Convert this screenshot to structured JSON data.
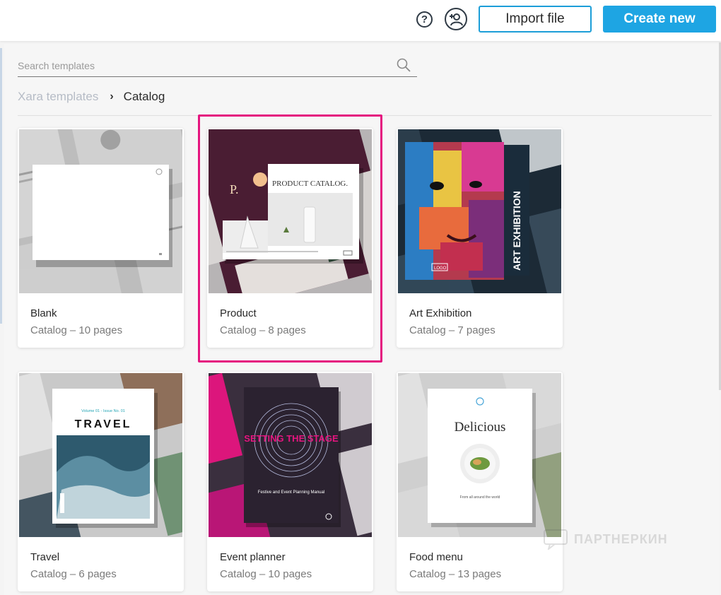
{
  "header": {
    "help_icon_glyph": "?",
    "import_label": "Import file",
    "create_label": "Create new"
  },
  "search": {
    "placeholder": "Search templates",
    "value": ""
  },
  "breadcrumb": {
    "root": "Xara templates",
    "separator": "›",
    "current": "Catalog"
  },
  "templates": [
    {
      "title": "Blank",
      "subtitle": "Catalog – 10 pages"
    },
    {
      "title": "Product",
      "subtitle": "Catalog – 8 pages",
      "selected": true,
      "thumb": {
        "letter": "P.",
        "heading": "PRODUCT CATALOG."
      }
    },
    {
      "title": "Art Exhibition",
      "subtitle": "Catalog – 7 pages",
      "thumb": {
        "heading": "ART EXHIBITION",
        "badge": "LOGO"
      }
    },
    {
      "title": "Travel",
      "subtitle": "Catalog – 6 pages",
      "thumb": {
        "issue": "Volume 01 - Issue No. 01",
        "heading": "TRAVEL"
      }
    },
    {
      "title": "Event planner",
      "subtitle": "Catalog – 10 pages",
      "thumb": {
        "heading": "SETTING THE STAGE",
        "subheading": "Festive and Event Planning Manual"
      }
    },
    {
      "title": "Food menu",
      "subtitle": "Catalog – 13 pages",
      "thumb": {
        "heading": "Delicious",
        "tagline": "From all around the world"
      }
    }
  ],
  "watermark": "ПАРТНЕРКИН",
  "colors": {
    "accent": "#1ea5e3",
    "selection": "#e5157f",
    "product_maroon": "#4a1d33",
    "art_navy": "#15232f",
    "event_purple": "#2b2230",
    "event_pink": "#e5157f"
  }
}
